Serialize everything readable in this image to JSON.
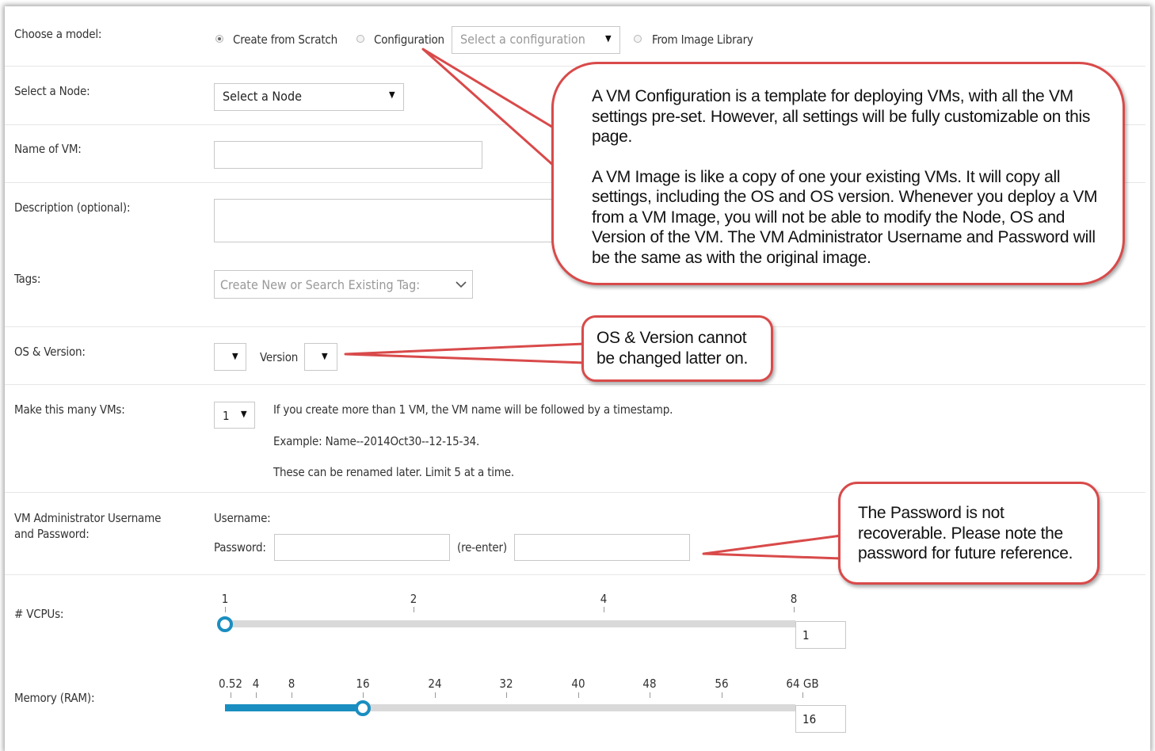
{
  "model": {
    "label": "Choose a model:",
    "options": [
      {
        "label": "Create from Scratch",
        "selected": true
      },
      {
        "label": "Configuration",
        "selected": false
      },
      {
        "label": "From Image Library",
        "selected": false
      }
    ],
    "configuration_select": "Select a configuration"
  },
  "node": {
    "label": "Select a Node:",
    "select": "Select a Node"
  },
  "name": {
    "label": "Name of VM:",
    "value": ""
  },
  "description": {
    "label": "Description (optional):",
    "value": ""
  },
  "tags": {
    "label": "Tags:",
    "placeholder": "Create New or Search Existing Tag:"
  },
  "os": {
    "label": "OS & Version:",
    "version_label": "Version"
  },
  "count": {
    "label": "Make this many VMs:",
    "value": "1",
    "notes": [
      "If you create more than 1 VM, the VM name will be followed by a timestamp.",
      "Example: Name--2014Oct30--12-15-34.",
      "These can be renamed later. Limit 5 at a time."
    ]
  },
  "admin": {
    "label_line1": "VM Administrator Username",
    "label_line2": "and Password:",
    "username_label": "Username:",
    "password_label": "Password:",
    "reenter_label": "(re-enter)"
  },
  "vcpus": {
    "label": "# VCPUs:",
    "ticks": [
      "1",
      "2",
      "4",
      "8"
    ],
    "value": "1"
  },
  "memory": {
    "label": "Memory (RAM):",
    "ticks": [
      "0.52",
      "4",
      "8",
      "16",
      "24",
      "32",
      "40",
      "48",
      "56",
      "64 GB"
    ],
    "value": "16"
  },
  "callouts": {
    "vm_info_p1": "A VM Configuration is a template for deploying VMs, with all the VM settings pre-set. However, all settings will be fully customizable on this page.",
    "vm_info_p2": "A VM Image is like a copy of one your existing VMs. It will copy all settings, including the OS and OS version. Whenever you deploy a VM from a VM Image, you will not be able to modify the Node, OS and Version of the VM. The VM Administrator Username and Password will be the same as with the original image.",
    "os_note": "OS & Version cannot be changed latter on.",
    "password_note": "The Password is not recoverable. Please note the password for future reference."
  },
  "colors": {
    "accent": "#1a8ec0",
    "callout_border": "#d94a4a"
  }
}
